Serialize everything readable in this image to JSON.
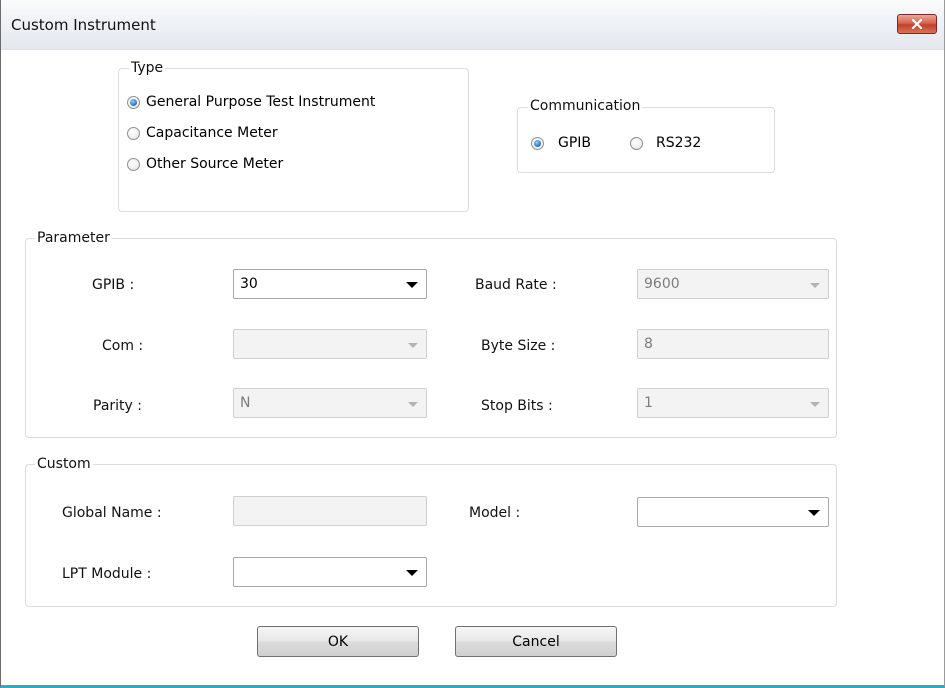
{
  "window": {
    "title": "Custom Instrument"
  },
  "type_group": {
    "label": "Type",
    "options": [
      {
        "label": "General Purpose Test Instrument",
        "checked": true
      },
      {
        "label": "Capacitance Meter",
        "checked": false
      },
      {
        "label": "Other Source Meter",
        "checked": false
      }
    ]
  },
  "communication_group": {
    "label": "Communication",
    "options": [
      {
        "label": "GPIB",
        "checked": true
      },
      {
        "label": "RS232",
        "checked": false
      }
    ]
  },
  "parameter_group": {
    "label": "Parameter",
    "gpib": {
      "label": "GPIB :",
      "value": "30"
    },
    "com": {
      "label": "Com :",
      "value": ""
    },
    "parity": {
      "label": "Parity :",
      "value": "N"
    },
    "baud_rate": {
      "label": "Baud Rate :",
      "value": "9600"
    },
    "byte_size": {
      "label": "Byte Size :",
      "value": "8"
    },
    "stop_bits": {
      "label": "Stop Bits :",
      "value": "1"
    }
  },
  "custom_group": {
    "label": "Custom",
    "global_name": {
      "label": "Global Name :",
      "value": ""
    },
    "model": {
      "label": "Model :",
      "value": ""
    },
    "lpt_module": {
      "label": "LPT Module :",
      "value": ""
    }
  },
  "buttons": {
    "ok": "OK",
    "cancel": "Cancel"
  }
}
